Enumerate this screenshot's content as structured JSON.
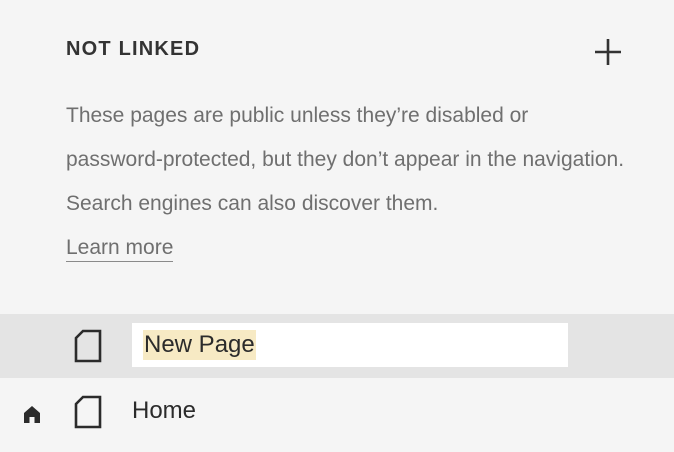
{
  "section": {
    "title": "NOT LINKED",
    "add_icon": "plus-icon",
    "description": "These pages are public unless they’re disabled or password-protected, but they don’t appear in the navigation. Search engines can also discover them.",
    "learn_more": "Learn more"
  },
  "pages": {
    "editing_name": "New Page",
    "home_label": "Home"
  },
  "colors": {
    "background": "#f5f5f5",
    "selected_row": "#e4e4e4",
    "text_highlight": "#f7eac4",
    "muted_text": "#6f6f6f"
  }
}
